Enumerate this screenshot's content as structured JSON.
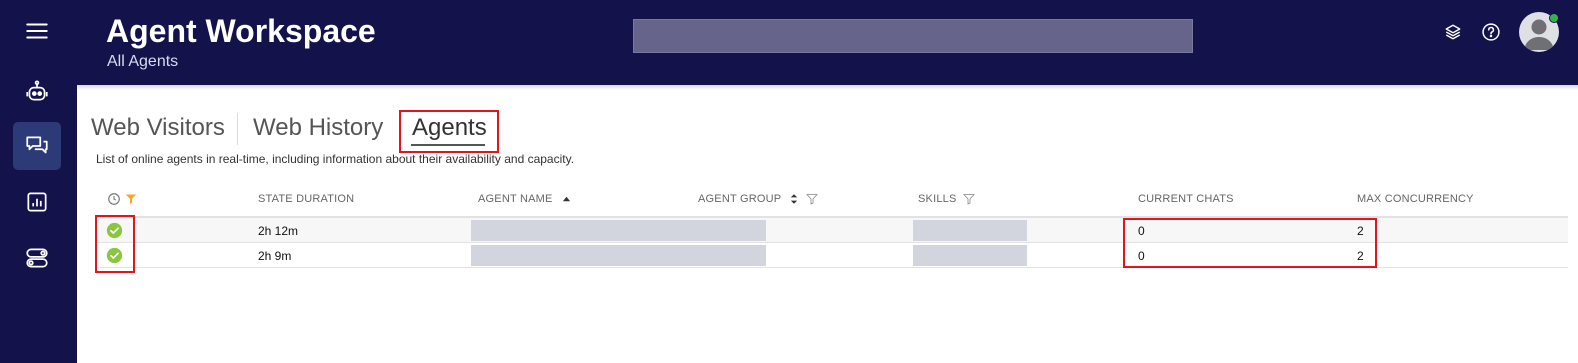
{
  "header": {
    "title": "Agent Workspace",
    "subtitle": "All Agents",
    "search_value": ""
  },
  "sidebar": {
    "items": [
      {
        "icon": "menu-icon"
      },
      {
        "icon": "robot-icon"
      },
      {
        "icon": "chat-bubbles-icon",
        "active": true
      },
      {
        "icon": "bar-chart-icon"
      },
      {
        "icon": "settings-toggles-icon"
      }
    ]
  },
  "header_icons": [
    "layers-icon",
    "help-icon",
    "avatar"
  ],
  "tabs": [
    {
      "label": "Web Visitors"
    },
    {
      "label": "Web History"
    },
    {
      "label": "Agents",
      "active": true
    }
  ],
  "description": "List of online agents in real-time, including information about their availability and capacity.",
  "table": {
    "columns": [
      {
        "label": "",
        "icons": [
          "clock-icon",
          "filter-icon"
        ]
      },
      {
        "label": "STATE DURATION"
      },
      {
        "label": "AGENT NAME",
        "sort": "ascending"
      },
      {
        "label": "AGENT GROUP",
        "sort": "sortable",
        "filter": true
      },
      {
        "label": "SKILLS",
        "filter": true
      },
      {
        "label": "CURRENT CHATS"
      },
      {
        "label": "MAX CONCURRENCY"
      }
    ],
    "rows": [
      {
        "status": "available",
        "state_duration": "2h 12m",
        "agent_name": "",
        "agent_group": "",
        "skills": "",
        "current_chats": "0",
        "max_concurrency": "2"
      },
      {
        "status": "available",
        "state_duration": "2h 9m",
        "agent_name": "",
        "agent_group": "",
        "skills": "",
        "current_chats": "0",
        "max_concurrency": "2"
      }
    ]
  },
  "colors": {
    "sidebar_bg": "#14124a",
    "active_nav": "#2d3a78",
    "search_bg": "#66648a",
    "highlight_red": "#e3141b",
    "status_green": "#8cc63f",
    "filter_orange": "#f5a623",
    "presence_green": "#36b34a"
  }
}
